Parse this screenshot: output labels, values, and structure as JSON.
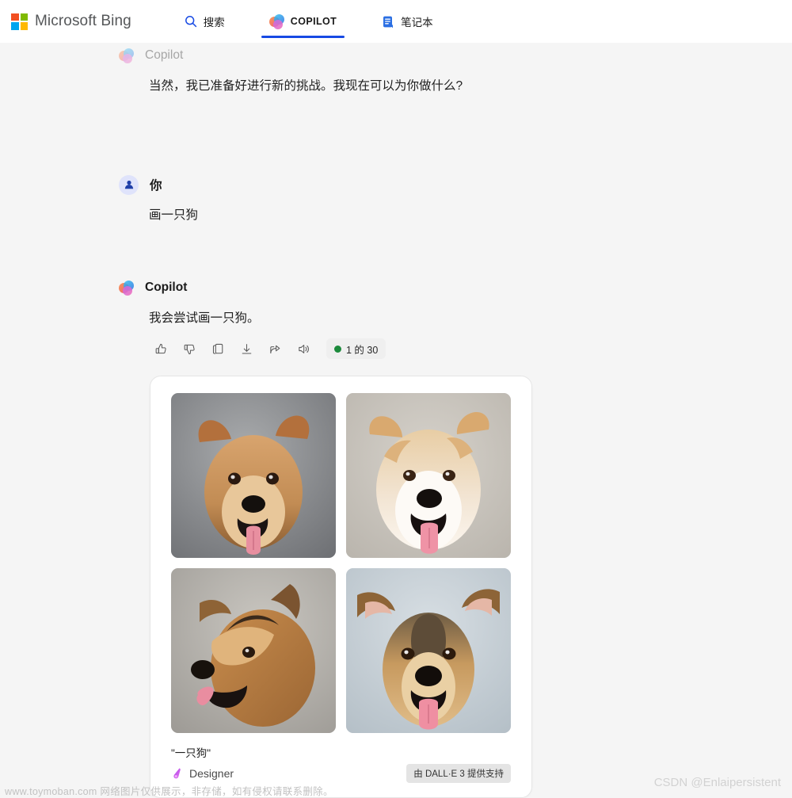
{
  "header": {
    "brand": "Microsoft Bing",
    "logo_icon": "microsoft-logo-icon",
    "tabs": [
      {
        "label": "搜索",
        "icon": "search-icon",
        "active": false
      },
      {
        "label": "COPILOT",
        "icon": "copilot-icon",
        "active": true
      },
      {
        "label": "笔记本",
        "icon": "notebook-icon",
        "active": false
      }
    ],
    "accent_color": "#174ae4"
  },
  "conversation": {
    "messages": [
      {
        "author": "Copilot",
        "avatar_icon": "copilot-icon",
        "text": "当然，我已准备好进行新的挑战。我现在可以为你做什么?"
      },
      {
        "author": "你",
        "avatar_icon": "user-person-icon",
        "text": "画一只狗"
      },
      {
        "author": "Copilot",
        "avatar_icon": "copilot-icon",
        "text": "我会尝试画一只狗。"
      }
    ]
  },
  "actions": {
    "items": [
      {
        "name": "thumbs-up-icon",
        "label": "赞"
      },
      {
        "name": "thumbs-down-icon",
        "label": "踩"
      },
      {
        "name": "copy-icon",
        "label": "复制"
      },
      {
        "name": "download-icon",
        "label": "下载"
      },
      {
        "name": "share-icon",
        "label": "共享"
      },
      {
        "name": "speaker-icon",
        "label": "朗读"
      }
    ],
    "counter_text": "1 的 30",
    "counter_dot_color": "#1c8a3c"
  },
  "image_card": {
    "caption": "\"一只狗\"",
    "designer_label": "Designer",
    "designer_icon": "designer-icon",
    "powered_badge": "由 DALL·E 3 提供支持",
    "images": [
      {
        "alt": "棕色狗张嘴吐舌特写",
        "bg": "#8d8f92"
      },
      {
        "alt": "白棕色长毛狗张嘴吐舌",
        "bg": "#c7c3bd"
      },
      {
        "alt": "德国牧羊犬混种侧脸吐舌",
        "bg": "#b3b1ac"
      },
      {
        "alt": "德国牧羊犬混种正面吐舌",
        "bg": "#c3cdd3"
      }
    ]
  },
  "watermarks": {
    "left": "www.toymoban.com 网络图片仅供展示，非存储，如有侵权请联系删除。",
    "right": "CSDN @Enlaipersistent"
  }
}
